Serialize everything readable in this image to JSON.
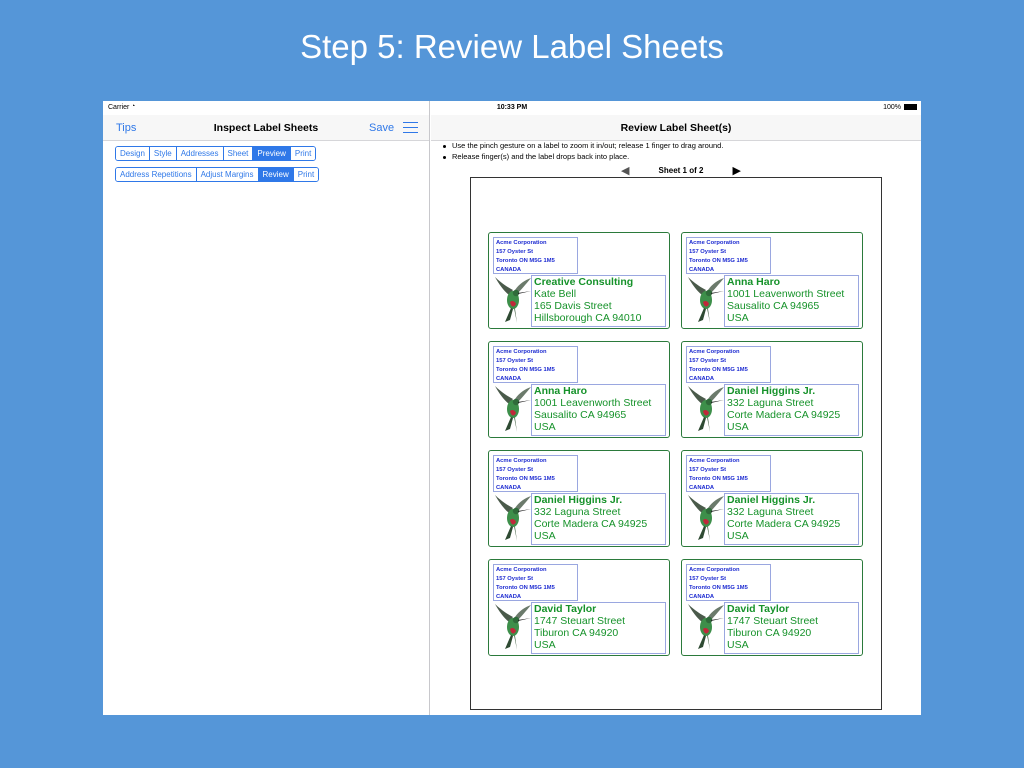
{
  "banner": "Step 5: Review Label Sheets",
  "status": {
    "carrier": "Carrier",
    "time": "10:33 PM",
    "battery": "100%"
  },
  "left": {
    "nav": {
      "tips": "Tips",
      "title": "Inspect Label Sheets",
      "save": "Save"
    },
    "tabs1": [
      "Design",
      "Style",
      "Addresses",
      "Sheet",
      "Preview",
      "Print"
    ],
    "tabs1_active": "Preview",
    "tabs2": [
      "Address Repetitions",
      "Adjust Margins",
      "Review",
      "Print"
    ],
    "tabs2_active": "Review"
  },
  "right": {
    "nav": {
      "title": "Review Label Sheet(s)"
    },
    "instructions": [
      "Use the pinch gesture on a label to zoom it in/out; release 1 finger to drag around.",
      "Release finger(s) and the label drops back into place."
    ],
    "pager": {
      "label": "Sheet 1 of 2"
    },
    "return_address": [
      "Acme Corporation",
      "157 Oyster St",
      "Toronto ON M5G 1M5",
      "CANADA"
    ],
    "labels": [
      {
        "lines": [
          "Creative Consulting",
          "Kate Bell",
          "165 Davis Street",
          "Hillsborough CA 94010"
        ]
      },
      {
        "lines": [
          "Anna Haro",
          "1001  Leavenworth Street",
          "Sausalito CA 94965",
          "USA"
        ]
      },
      {
        "lines": [
          "Anna Haro",
          "1001  Leavenworth Street",
          "Sausalito CA 94965",
          "USA"
        ]
      },
      {
        "lines": [
          "Daniel Higgins Jr.",
          "332 Laguna Street",
          "Corte Madera CA 94925",
          "USA"
        ]
      },
      {
        "lines": [
          "Daniel Higgins Jr.",
          "332 Laguna Street",
          "Corte Madera CA 94925",
          "USA"
        ]
      },
      {
        "lines": [
          "Daniel Higgins Jr.",
          "332 Laguna Street",
          "Corte Madera CA 94925",
          "USA"
        ]
      },
      {
        "lines": [
          "David Taylor",
          "1747 Steuart Street",
          "Tiburon CA 94920",
          "USA"
        ]
      },
      {
        "lines": [
          "David Taylor",
          "1747 Steuart Street",
          "Tiburon CA 94920",
          "USA"
        ]
      }
    ]
  },
  "colors": {
    "accent": "#2f78e8",
    "recipient_text": "#16922a",
    "return_text": "#1d2bd1",
    "background": "#5596d8"
  }
}
